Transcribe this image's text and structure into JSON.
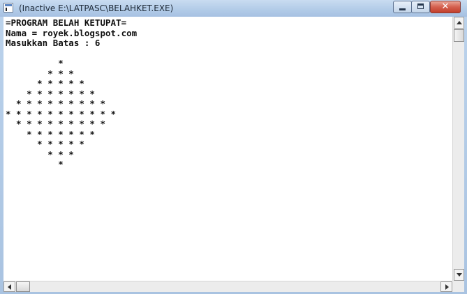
{
  "window": {
    "title": "(Inactive E:\\LATPASC\\BELAHKET.EXE)",
    "icon": "console-window-icon",
    "controls": {
      "minimize_icon": "minimize-icon",
      "maximize_icon": "maximize-icon",
      "close_label": "✕"
    }
  },
  "console": {
    "lines": [
      "=PROGRAM BELAH KETUPAT=",
      "Nama = royek.blogspot.com",
      "Masukkan Batas : 6",
      "",
      "          *",
      "        * * *",
      "      * * * * *",
      "    * * * * * * *",
      "  * * * * * * * * *",
      "* * * * * * * * * * *",
      "  * * * * * * * * *",
      "    * * * * * * *",
      "      * * * * *",
      "        * * *",
      "          *"
    ]
  },
  "colors": {
    "text": "#111111",
    "background": "#ffffff",
    "close_button": "#c94a38"
  }
}
